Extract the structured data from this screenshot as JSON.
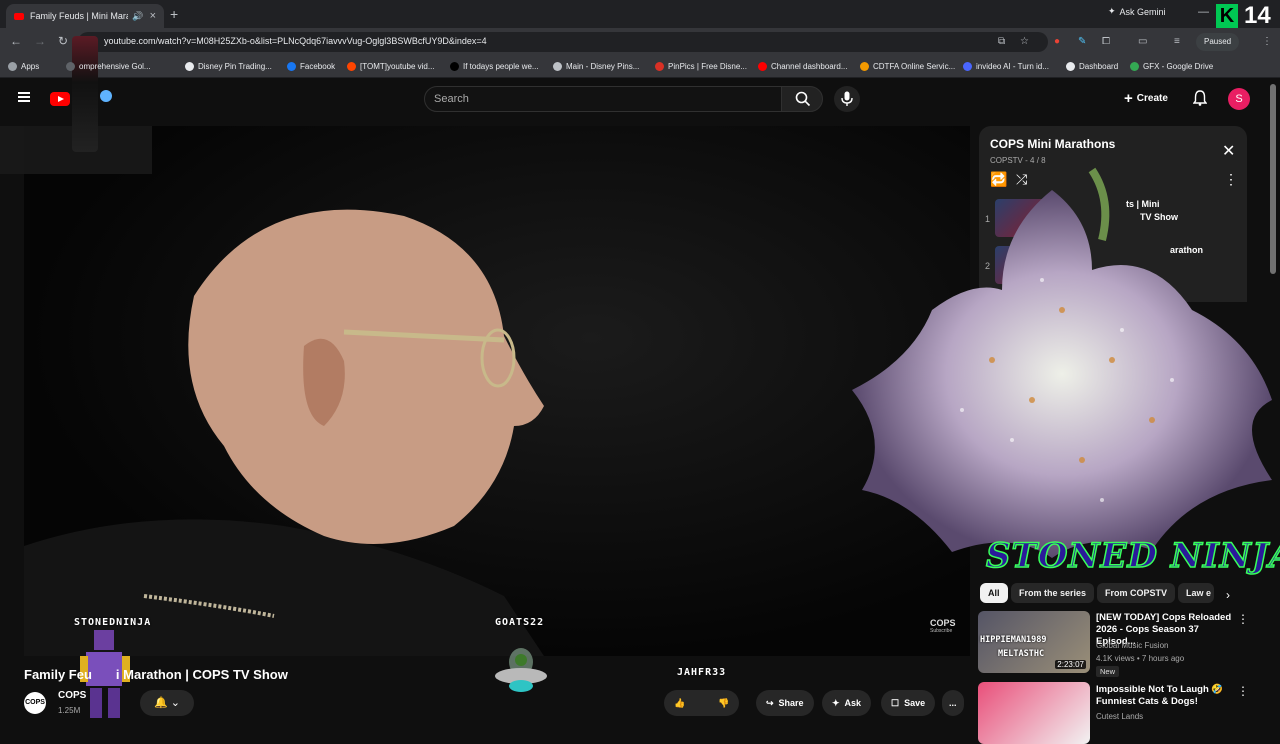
{
  "browser": {
    "tab_title": "Family Feuds | Mini Marathon",
    "new_tab": "+",
    "close": "×",
    "url": "youtube.com/watch?v=M08H25ZXb-o&list=PLNcQdq67iavvvVug-Oglgl3BSWBcfUY9D&index=4",
    "ask_gemini": "Ask Gemini",
    "profile_status": "Paused",
    "counter": "14",
    "k_badge": "K",
    "bookmarks": [
      {
        "label": "Apps",
        "color": "#9aa0a6"
      },
      {
        "label": "omprehensive Gol...",
        "color": "#5f6368"
      },
      {
        "label": "Disney Pin Trading...",
        "color": "#e8eaed"
      },
      {
        "label": "Facebook",
        "color": "#1877f2"
      },
      {
        "label": "[TOMT]youtube vid...",
        "color": "#ff4500"
      },
      {
        "label": "If todays people we...",
        "color": "#000000"
      },
      {
        "label": "Main - Disney Pins...",
        "color": "#bdc1c6"
      },
      {
        "label": "PinPics | Free Disne...",
        "color": "#d93025"
      },
      {
        "label": "Channel dashboard...",
        "color": "#ff0000"
      },
      {
        "label": "CDTFA Online Servic...",
        "color": "#f29900"
      },
      {
        "label": "invideo AI - Turn id...",
        "color": "#4a66ff"
      },
      {
        "label": "Dashboard",
        "color": "#e8eaed"
      },
      {
        "label": "GFX - Google Drive",
        "color": "#34a853"
      }
    ]
  },
  "youtube": {
    "search_placeholder": "Search",
    "create_label": "Create",
    "avatar_letter": "S",
    "video_title": "Family Feuds | Mini Marathon | COPS TV Show",
    "title_visible_start": "Family Feu",
    "title_visible_end": "i Marathon | COPS TV Show",
    "channel_name": "COPS",
    "channel_subs": "1.25M",
    "channel_logo_text": "COPS",
    "actions": {
      "share": "Share",
      "ask": "Ask",
      "save": "Save",
      "more": "..."
    },
    "overlay_viewers": [
      "STONEDNINJA",
      "GOATS22",
      "JAHFR33"
    ],
    "watermark": "COPS",
    "watermark_sub": "Subscribe"
  },
  "playlist": {
    "title": "COPS Mini Marathons",
    "channel": "COPSTV",
    "position": "4 / 8",
    "items": [
      {
        "index": "1",
        "title_line1": "ts | Mini",
        "title_line2": "TV Show"
      },
      {
        "index": "2",
        "title_line1": "arathon",
        "title_line2": ""
      }
    ]
  },
  "overlay_brand": "STONED NINJA",
  "chips": [
    "All",
    "From the series",
    "From COPSTV",
    "Law e"
  ],
  "recommendations": [
    {
      "title": "[NEW TODAY] Cops Reloaded 2026 - Cops Season 37 Episod...",
      "channel": "Global Music Fusion",
      "meta": "4.1K views • 7 hours ago",
      "badge": "New",
      "duration": "2:23:07",
      "overlay_names": [
        "HIPPIEMAN1989",
        "MELTASTHC"
      ]
    },
    {
      "title": "Impossible Not To Laugh 🤣 Funniest Cats & Dogs!",
      "channel": "Cutest Lands"
    }
  ]
}
